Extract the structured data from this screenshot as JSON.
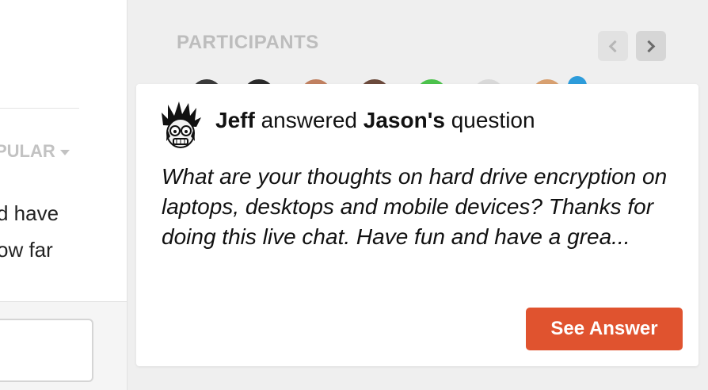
{
  "left_panel": {
    "sort_label": "PULAR",
    "question_lines": [
      "d have",
      "ow far"
    ]
  },
  "participants": {
    "title": "PARTICIPANTS"
  },
  "notification": {
    "author": "Jeff",
    "action": "answered",
    "target": "Jason's",
    "noun": "question",
    "question_text": "What are your thoughts on hard drive encryption on laptops, desktops and mobile devices? Thanks for doing this live chat. Have fun and have a grea...",
    "button_label": "See Answer"
  },
  "colors": {
    "accent_button": "#e0532f",
    "badge_blue": "#2d9cdb"
  },
  "icons": {
    "prev": "chevron-left-icon",
    "next": "chevron-right-icon",
    "sort": "caret-down-icon",
    "avatar": "cartoon-avatar-icon"
  }
}
